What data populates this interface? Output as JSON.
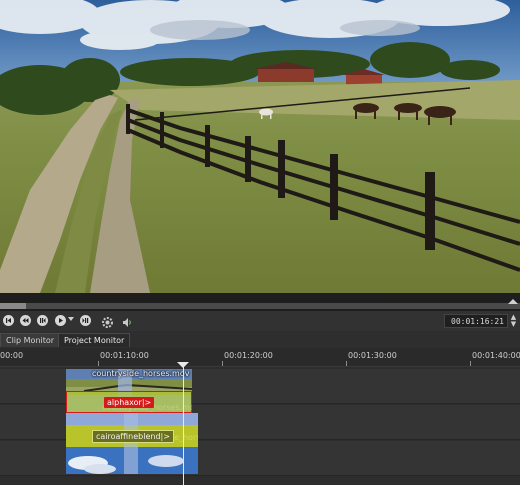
{
  "transport": {
    "timecode": "00:01:16:21",
    "spin_icon": "spinbox-arrows-icon",
    "buttons": [
      "skip-to-start-icon",
      "rewind-icon",
      "previous-icon",
      "play-icon",
      "next-icon",
      "settings-icon",
      "volume-icon"
    ]
  },
  "tabs": [
    {
      "label": "Clip Monitor",
      "active": false
    },
    {
      "label": "Project Monitor",
      "active": true
    }
  ],
  "ruler": {
    "labels": [
      "00:00",
      "00:01:10:00",
      "00:01:20:00",
      "00:01:30:00",
      "00:01:40:00"
    ]
  },
  "clips": {
    "video_clip_name": "countryside_horses.mov",
    "overlay_clip_name_1": "countryside_horses.mov",
    "overlay_clip_name_2": "countryside_horses.mov"
  },
  "filters": {
    "alphaxor": "alphaxor|>",
    "cairoaffine": "cairoaffineblend|>"
  },
  "colors": {
    "accent_red": "#d41a1a",
    "filter_green": "#b8c42a",
    "clip_blue": "#8fa8d8"
  }
}
